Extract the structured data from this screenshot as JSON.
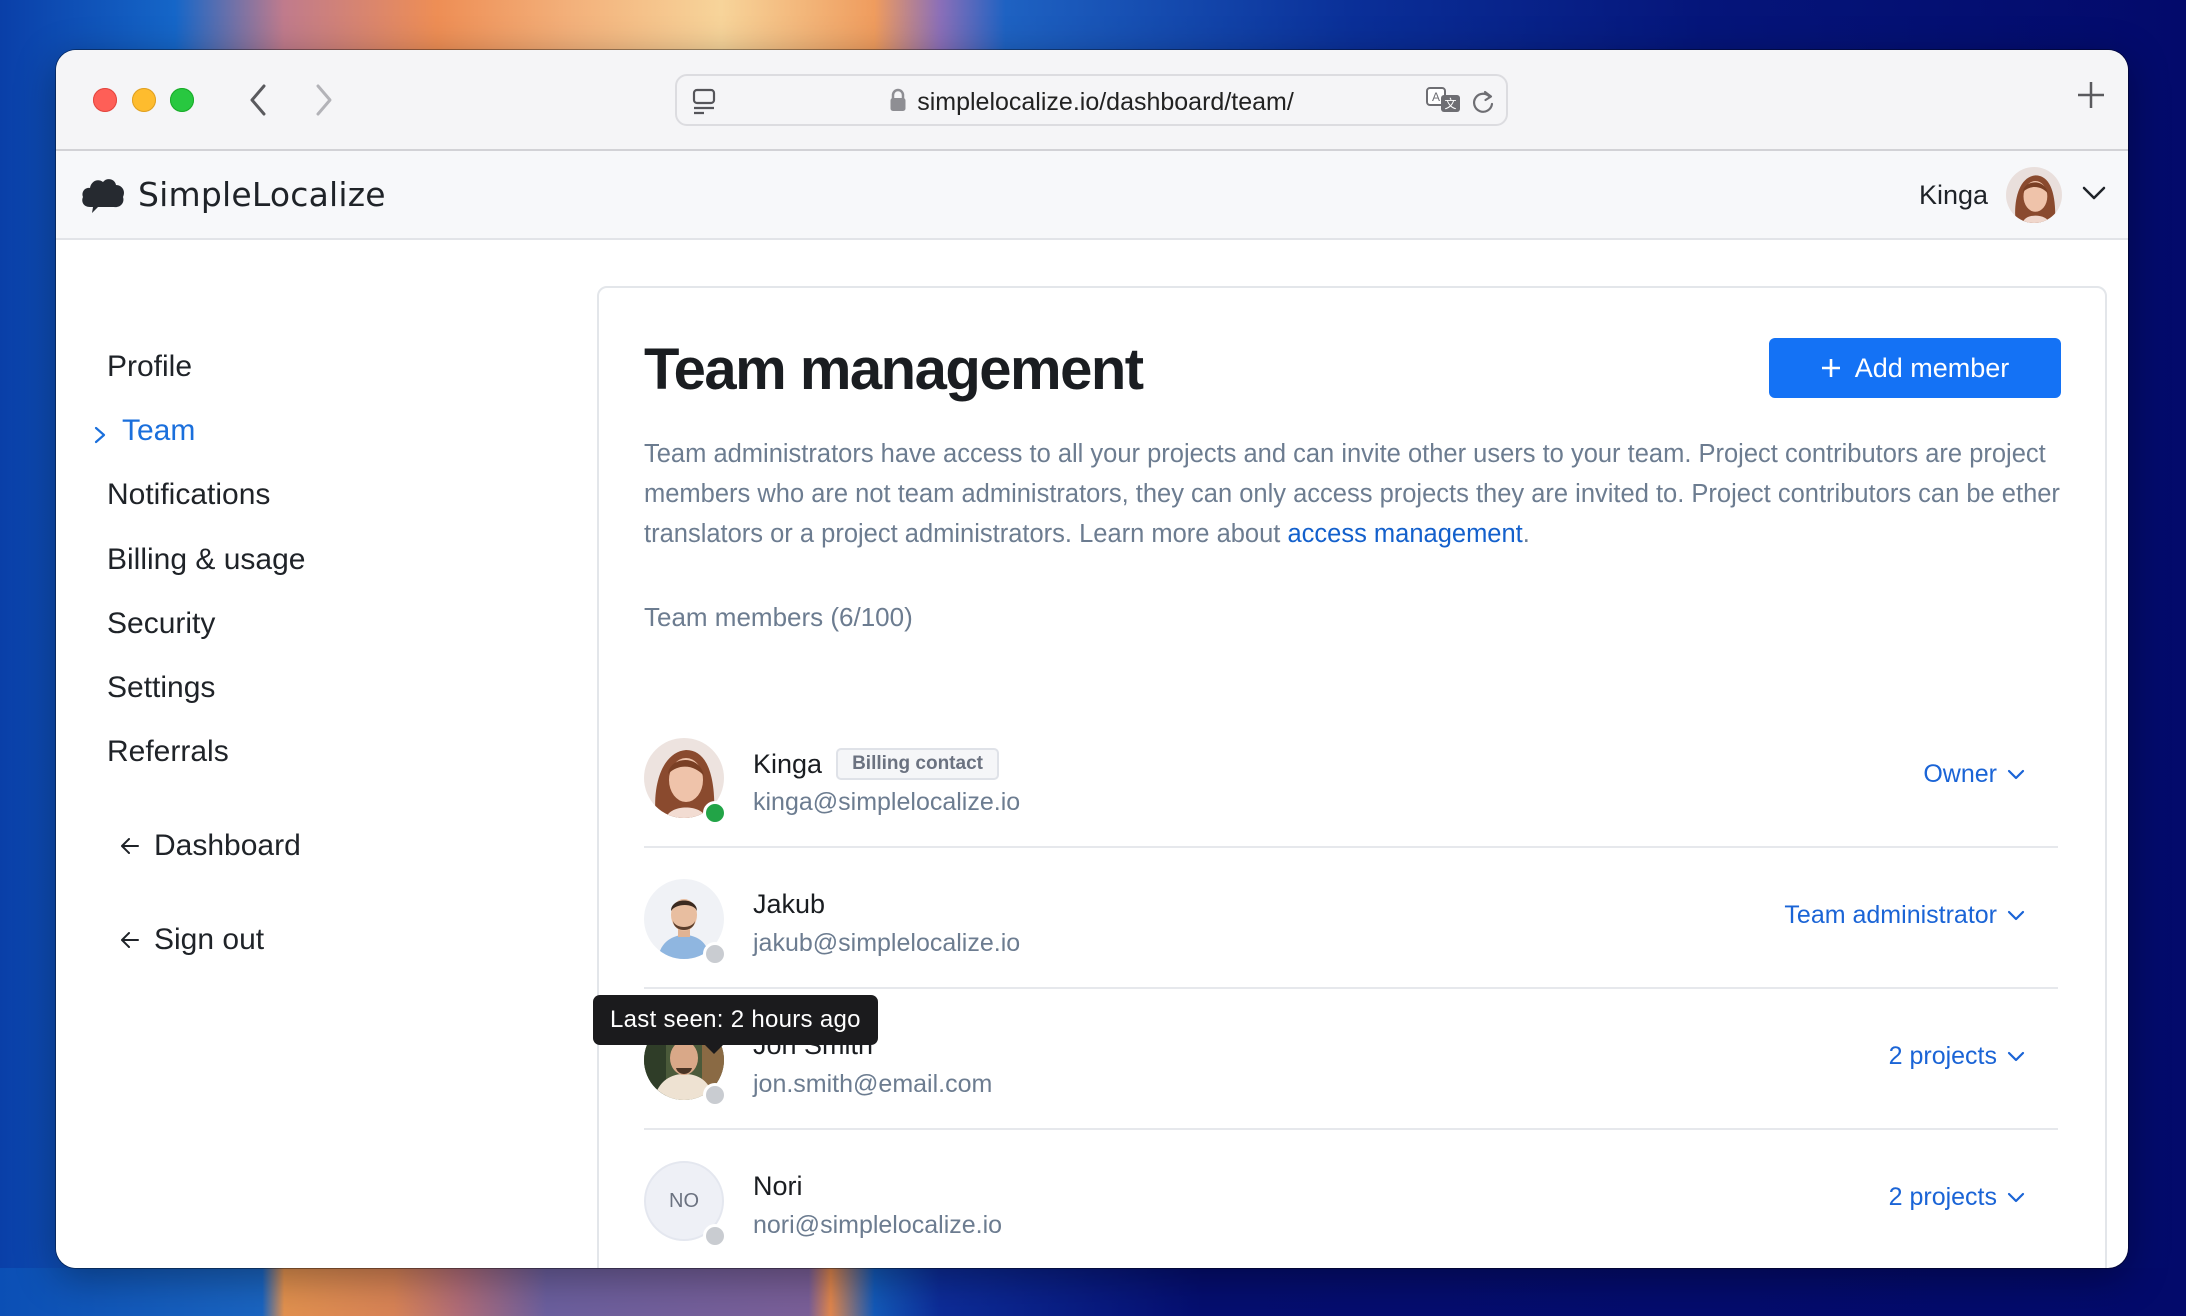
{
  "browser": {
    "url": "simplelocalize.io/dashboard/team/",
    "icons": {
      "back": "chevron-left-icon",
      "forward": "chevron-right-icon",
      "sidebar": "sidebar-icon",
      "lock": "lock-icon",
      "translate": "translate-icon",
      "reload": "reload-icon",
      "new_tab": "plus-icon"
    }
  },
  "header": {
    "brand": "SimpleLocalize",
    "user_name": "Kinga"
  },
  "sidebar": {
    "items": [
      {
        "label": "Profile",
        "active": false
      },
      {
        "label": "Team",
        "active": true
      },
      {
        "label": "Notifications",
        "active": false
      },
      {
        "label": "Billing & usage",
        "active": false
      },
      {
        "label": "Security",
        "active": false
      },
      {
        "label": "Settings",
        "active": false
      },
      {
        "label": "Referrals",
        "active": false
      }
    ],
    "links": [
      {
        "label": "Dashboard"
      },
      {
        "label": "Sign out"
      }
    ]
  },
  "main": {
    "title": "Team management",
    "add_button": "Add member",
    "description": "Team administrators have access to all your projects and can invite other users to your team. Project contributors are project members who are not team administrators, they can only access projects they are invited to. Project contributors can be ether translators or a project administrators. Learn more about ",
    "description_link": "access management",
    "description_end": ".",
    "members_label": "Team members (6/100)",
    "members": [
      {
        "name": "Kinga",
        "email": "kinga@simplelocalize.io",
        "badge": "Billing contact",
        "role": "Owner",
        "status": "online",
        "initials": ""
      },
      {
        "name": "Jakub",
        "email": "jakub@simplelocalize.io",
        "badge": "",
        "role": "Team administrator",
        "status": "offline",
        "initials": ""
      },
      {
        "name": "Jon Smith",
        "email": "jon.smith@email.com",
        "badge": "",
        "role": "2 projects",
        "status": "offline",
        "initials": ""
      },
      {
        "name": "Nori",
        "email": "nori@simplelocalize.io",
        "badge": "",
        "role": "2 projects",
        "status": "offline",
        "initials": "NO"
      }
    ],
    "tooltip": "Last seen: 2 hours ago"
  },
  "colors": {
    "accent": "#1472f5",
    "link": "#1a64d6",
    "online": "#22a447",
    "offline": "#c9ccd1",
    "muted_text": "#6c7c90"
  }
}
